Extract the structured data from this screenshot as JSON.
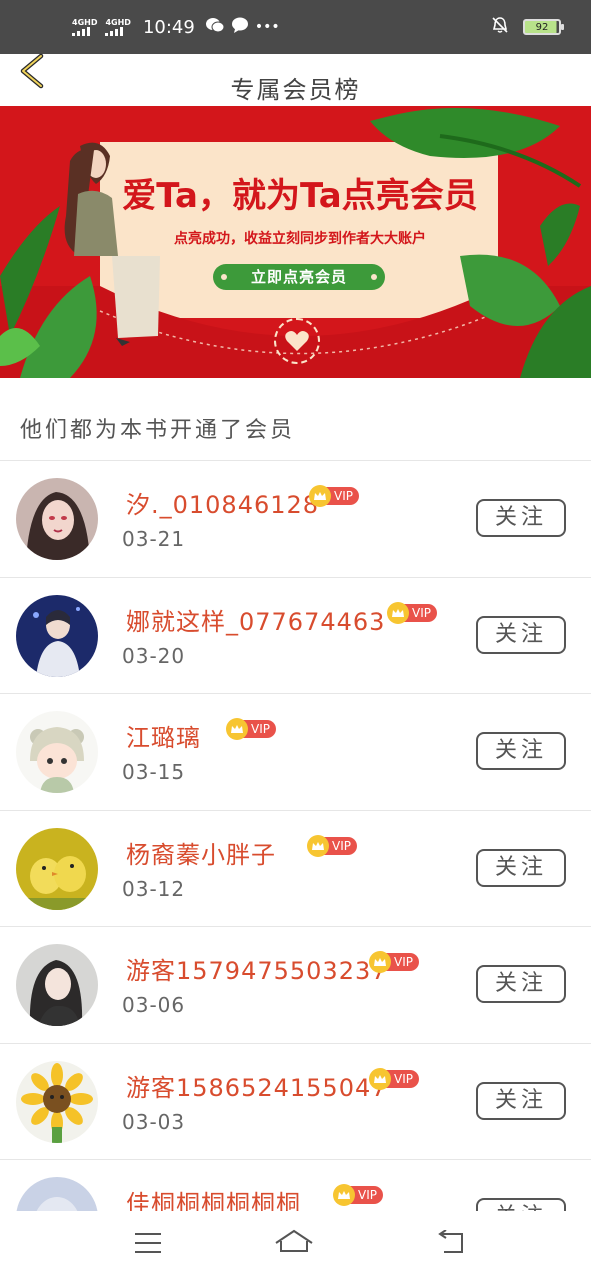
{
  "status_bar": {
    "signal1_label": "4GHD",
    "signal2_label": "4GHD",
    "time": "10:49",
    "more": "•••",
    "battery": "92"
  },
  "header": {
    "title": "专属会员榜",
    "back_icon": "chevron-left-icon"
  },
  "banner": {
    "title": "爱Ta，就为Ta点亮会员",
    "subtitle": "点亮成功，收益立刻同步到作者大大账户",
    "button": "立即点亮会员",
    "colors": {
      "background": "#d3161b",
      "card": "#fbe4c9",
      "button": "#3d9a3a"
    }
  },
  "section": {
    "title": "他们都为本书开通了会员"
  },
  "vip_label": "VIP",
  "follow_label": "关注",
  "members": [
    {
      "name": "汐._010846128",
      "date": "03-21",
      "avatar": "girl-portrait"
    },
    {
      "name": "娜就这样_077674463",
      "date": "03-20",
      "avatar": "singer-portrait"
    },
    {
      "name": "江璐璃",
      "date": "03-15",
      "avatar": "cartoon-child"
    },
    {
      "name": "杨裔蓁小胖子",
      "date": "03-12",
      "avatar": "chicks-photo"
    },
    {
      "name": "游客15794755032​37",
      "date": "03-06",
      "avatar": "girl-dark-photo"
    },
    {
      "name": "游客15865241550​47",
      "date": "03-03",
      "avatar": "sunflower-cartoon"
    },
    {
      "name": "佳桐桐桐桐桐桐",
      "date": "",
      "avatar": "blurred-photo"
    }
  ],
  "nav": {
    "menu_icon": "menu-icon",
    "home_icon": "home-icon",
    "back_icon": "back-arrow-icon"
  }
}
